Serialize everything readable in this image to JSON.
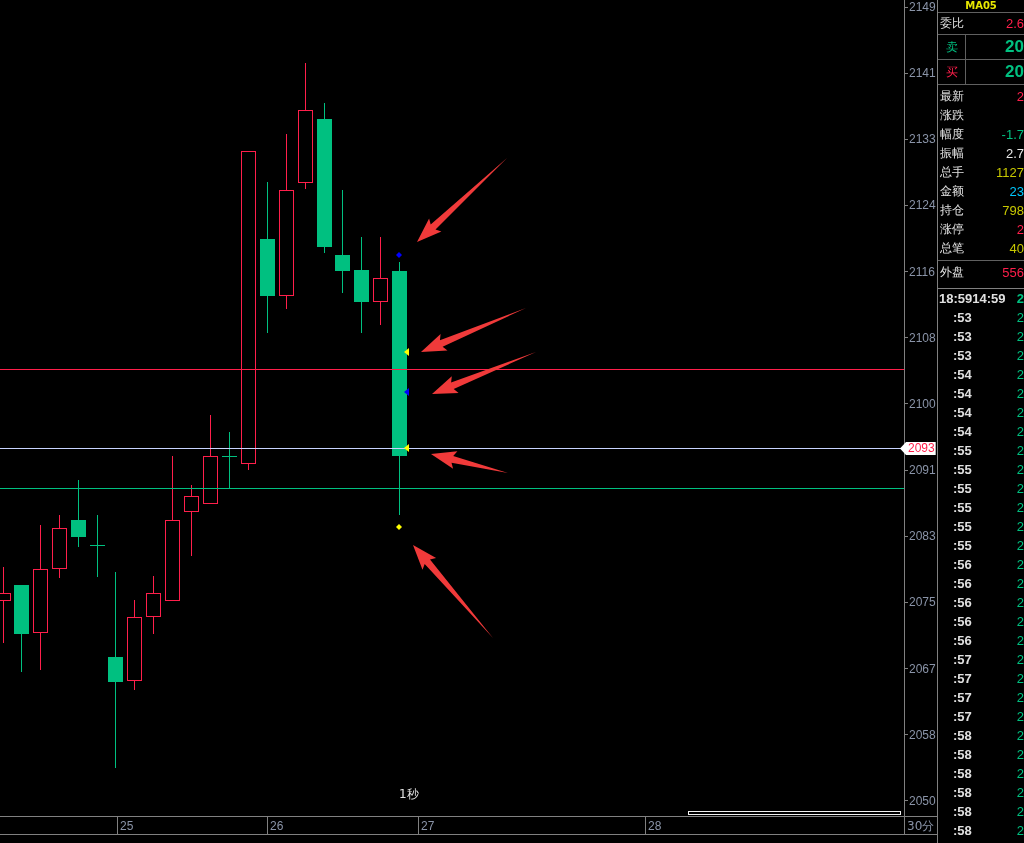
{
  "symbol": "MA05",
  "chart": {
    "interval_label": "1秒"
  },
  "price_axis": {
    "ticks": [
      "2149",
      "2141",
      "2133",
      "2124",
      "2116",
      "2108",
      "2100",
      "2091",
      "2083",
      "2075",
      "2067",
      "2058",
      "2050"
    ],
    "current_price": "2093"
  },
  "time_axis": {
    "labels": [
      "25",
      "26",
      "27",
      "28"
    ],
    "period": "30分"
  },
  "quote": {
    "ratio": {
      "label": "委比",
      "value": "2.6",
      "color": "#ff1f4b"
    },
    "ask": {
      "label": "卖",
      "value": "20"
    },
    "bid": {
      "label": "买",
      "value": "20"
    },
    "stats": [
      {
        "label": "最新",
        "value": "2",
        "color": "#ff1f4b"
      },
      {
        "label": "涨跌"
      },
      {
        "label": "幅度",
        "value": "-1.7",
        "color": "#00c080"
      },
      {
        "label": "振幅",
        "value": "2.7",
        "color": "#e8e8e8"
      },
      {
        "label": "总手",
        "value": "1127",
        "color": "#c8c800"
      },
      {
        "label": "金额",
        "value": "23",
        "color": "#00c8ff"
      },
      {
        "label": "持仓",
        "value": "798",
        "color": "#c8c800"
      },
      {
        "label": "涨停",
        "value": "2",
        "color": "#ff1f4b"
      },
      {
        "label": "总笔",
        "value": "40",
        "color": "#c8c800"
      }
    ],
    "outer": {
      "label": "外盘",
      "value": "556",
      "color": "#ff1f4b"
    }
  },
  "ticks": {
    "header": {
      "time": "18:59",
      "time2": "14:59",
      "value": "2"
    },
    "rows": [
      {
        "time": ":53",
        "value": "2"
      },
      {
        "time": ":53",
        "value": "2"
      },
      {
        "time": ":53",
        "value": "2"
      },
      {
        "time": ":54",
        "value": "2"
      },
      {
        "time": ":54",
        "value": "2"
      },
      {
        "time": ":54",
        "value": "2"
      },
      {
        "time": ":54",
        "value": "2"
      },
      {
        "time": ":55",
        "value": "2"
      },
      {
        "time": ":55",
        "value": "2"
      },
      {
        "time": ":55",
        "value": "2"
      },
      {
        "time": ":55",
        "value": "2"
      },
      {
        "time": ":55",
        "value": "2"
      },
      {
        "time": ":55",
        "value": "2"
      },
      {
        "time": ":56",
        "value": "2"
      },
      {
        "time": ":56",
        "value": "2"
      },
      {
        "time": ":56",
        "value": "2"
      },
      {
        "time": ":56",
        "value": "2"
      },
      {
        "time": ":56",
        "value": "2"
      },
      {
        "time": ":57",
        "value": "2"
      },
      {
        "time": ":57",
        "value": "2"
      },
      {
        "time": ":57",
        "value": "2"
      },
      {
        "time": ":57",
        "value": "2"
      },
      {
        "time": ":58",
        "value": "2"
      },
      {
        "time": ":58",
        "value": "2"
      },
      {
        "time": ":58",
        "value": "2"
      },
      {
        "time": ":58",
        "value": "2"
      },
      {
        "time": ":58",
        "value": "2"
      },
      {
        "time": ":58",
        "value": "2"
      }
    ]
  }
}
